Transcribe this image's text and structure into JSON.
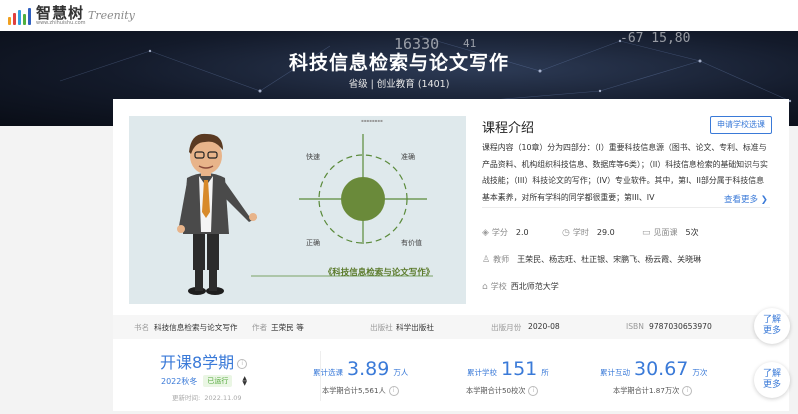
{
  "header": {
    "logo_cn": "智慧树",
    "logo_url": "www.zhihuishu.com",
    "logo_en": "Treenity"
  },
  "banner": {
    "title": "科技信息检索与论文写作",
    "subtitle": "省级 | 创业教育 (1401)",
    "deco_numbers": [
      "16330",
      "-67 15,80",
      "41"
    ]
  },
  "video": {
    "labels": {
      "fast": "快速",
      "accurate": "准确",
      "correct": "正确",
      "valuable": "有价值"
    },
    "caption": "《科技信息检索与论文写作》"
  },
  "intro": {
    "heading": "课程介绍",
    "apply_button": "申请学校选课",
    "body": "课程内容（10章）分为四部分：（I）重要科技信息源（图书、论文、专利、标准与产品资料、机构组织科技信息、数据库等6类）；（II）科技信息检索的基础知识与实战技能；（III）科技论文的写作；（IV）专业软件。其中，第I、II部分属于科技信息基本素养，对所有学科的同学都很重要；第III、IV",
    "more": "查看更多",
    "credits_label": "学分",
    "credits": "2.0",
    "hours_label": "学时",
    "hours": "29.0",
    "meet_label": "见面课",
    "meet": "5次",
    "teachers_label": "教师",
    "teachers": "王荣民、杨志旺、杜正银、宋鹏飞、杨云霞、关晓琳",
    "school_label": "学校",
    "school": "西北师范大学"
  },
  "book": {
    "name_label": "书名",
    "name": "科技信息检索与论文写作",
    "author_label": "作者",
    "author": "王荣民 等",
    "publisher_label": "出版社",
    "publisher": "科学出版社",
    "date_label": "出版月份",
    "date": "2020-08",
    "isbn_label": "ISBN",
    "isbn": "9787030653970"
  },
  "stats": {
    "open_title": "开课8学期",
    "term": "2022秋冬",
    "status": "已运行",
    "updated_label": "更新时间:",
    "updated": "2022.11.09",
    "select_label": "累计选课",
    "select_num": "3.89",
    "select_unit": "万人",
    "select_sub": "本学期合计5,561人",
    "school_label": "累计学校",
    "school_num": "151",
    "school_unit": "所",
    "school_sub": "本学期合计50校次",
    "interact_label": "累计互动",
    "interact_num": "30.67",
    "interact_unit": "万次",
    "interact_sub": "本学期合计1.87万次"
  },
  "side_buttons": {
    "learn": "了解",
    "more": "更多"
  },
  "colors": {
    "accent": "#3a7ad8",
    "status_green": "#52a83a"
  }
}
